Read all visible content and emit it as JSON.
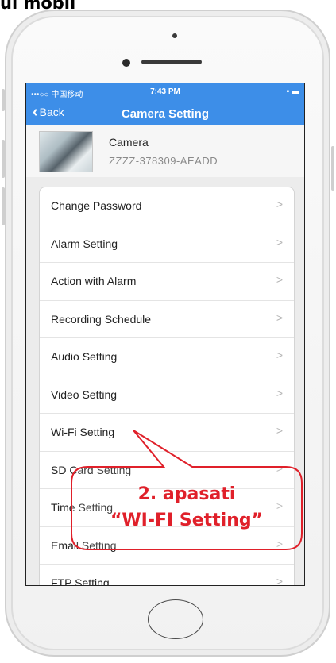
{
  "caption": "ul mobil",
  "status_bar": {
    "carrier": "•••○○ 中国移动 ",
    "time": "7:43 PM",
    "battery": "▪ ▬"
  },
  "nav": {
    "back_label": "Back",
    "title": "Camera Setting"
  },
  "device": {
    "name": "Camera",
    "id": "ZZZZ-378309-AEADD"
  },
  "settings": [
    {
      "label": "Change Password"
    },
    {
      "label": "Alarm Setting"
    },
    {
      "label": "Action with Alarm"
    },
    {
      "label": "Recording Schedule"
    },
    {
      "label": "Audio Setting"
    },
    {
      "label": "Video Setting"
    },
    {
      "label": "Wi-Fi Setting"
    },
    {
      "label": "SD Card Setting"
    },
    {
      "label": "Time Setting"
    },
    {
      "label": "Email Setting"
    },
    {
      "label": "FTP Setting"
    }
  ],
  "chevron": ">",
  "annotation": {
    "line1": "2. apasati",
    "line2": "“WI-FI Setting”",
    "color": "#e0202a"
  },
  "colors": {
    "accent": "#3d8ee8"
  }
}
